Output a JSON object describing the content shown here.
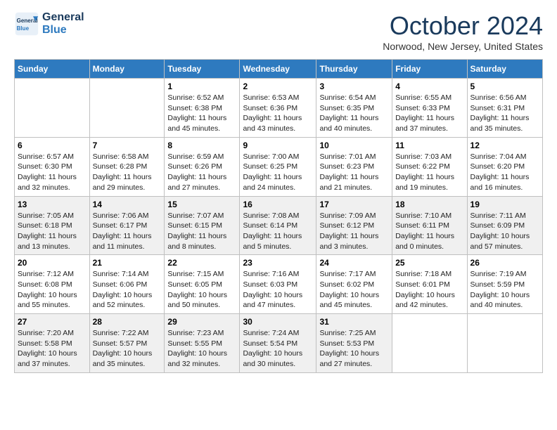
{
  "header": {
    "logo_general": "General",
    "logo_blue": "Blue",
    "month_title": "October 2024",
    "location": "Norwood, New Jersey, United States"
  },
  "weekdays": [
    "Sunday",
    "Monday",
    "Tuesday",
    "Wednesday",
    "Thursday",
    "Friday",
    "Saturday"
  ],
  "weeks": [
    [
      {
        "day": "",
        "info": ""
      },
      {
        "day": "",
        "info": ""
      },
      {
        "day": "1",
        "info": "Sunrise: 6:52 AM\nSunset: 6:38 PM\nDaylight: 11 hours and 45 minutes."
      },
      {
        "day": "2",
        "info": "Sunrise: 6:53 AM\nSunset: 6:36 PM\nDaylight: 11 hours and 43 minutes."
      },
      {
        "day": "3",
        "info": "Sunrise: 6:54 AM\nSunset: 6:35 PM\nDaylight: 11 hours and 40 minutes."
      },
      {
        "day": "4",
        "info": "Sunrise: 6:55 AM\nSunset: 6:33 PM\nDaylight: 11 hours and 37 minutes."
      },
      {
        "day": "5",
        "info": "Sunrise: 6:56 AM\nSunset: 6:31 PM\nDaylight: 11 hours and 35 minutes."
      }
    ],
    [
      {
        "day": "6",
        "info": "Sunrise: 6:57 AM\nSunset: 6:30 PM\nDaylight: 11 hours and 32 minutes."
      },
      {
        "day": "7",
        "info": "Sunrise: 6:58 AM\nSunset: 6:28 PM\nDaylight: 11 hours and 29 minutes."
      },
      {
        "day": "8",
        "info": "Sunrise: 6:59 AM\nSunset: 6:26 PM\nDaylight: 11 hours and 27 minutes."
      },
      {
        "day": "9",
        "info": "Sunrise: 7:00 AM\nSunset: 6:25 PM\nDaylight: 11 hours and 24 minutes."
      },
      {
        "day": "10",
        "info": "Sunrise: 7:01 AM\nSunset: 6:23 PM\nDaylight: 11 hours and 21 minutes."
      },
      {
        "day": "11",
        "info": "Sunrise: 7:03 AM\nSunset: 6:22 PM\nDaylight: 11 hours and 19 minutes."
      },
      {
        "day": "12",
        "info": "Sunrise: 7:04 AM\nSunset: 6:20 PM\nDaylight: 11 hours and 16 minutes."
      }
    ],
    [
      {
        "day": "13",
        "info": "Sunrise: 7:05 AM\nSunset: 6:18 PM\nDaylight: 11 hours and 13 minutes."
      },
      {
        "day": "14",
        "info": "Sunrise: 7:06 AM\nSunset: 6:17 PM\nDaylight: 11 hours and 11 minutes."
      },
      {
        "day": "15",
        "info": "Sunrise: 7:07 AM\nSunset: 6:15 PM\nDaylight: 11 hours and 8 minutes."
      },
      {
        "day": "16",
        "info": "Sunrise: 7:08 AM\nSunset: 6:14 PM\nDaylight: 11 hours and 5 minutes."
      },
      {
        "day": "17",
        "info": "Sunrise: 7:09 AM\nSunset: 6:12 PM\nDaylight: 11 hours and 3 minutes."
      },
      {
        "day": "18",
        "info": "Sunrise: 7:10 AM\nSunset: 6:11 PM\nDaylight: 11 hours and 0 minutes."
      },
      {
        "day": "19",
        "info": "Sunrise: 7:11 AM\nSunset: 6:09 PM\nDaylight: 10 hours and 57 minutes."
      }
    ],
    [
      {
        "day": "20",
        "info": "Sunrise: 7:12 AM\nSunset: 6:08 PM\nDaylight: 10 hours and 55 minutes."
      },
      {
        "day": "21",
        "info": "Sunrise: 7:14 AM\nSunset: 6:06 PM\nDaylight: 10 hours and 52 minutes."
      },
      {
        "day": "22",
        "info": "Sunrise: 7:15 AM\nSunset: 6:05 PM\nDaylight: 10 hours and 50 minutes."
      },
      {
        "day": "23",
        "info": "Sunrise: 7:16 AM\nSunset: 6:03 PM\nDaylight: 10 hours and 47 minutes."
      },
      {
        "day": "24",
        "info": "Sunrise: 7:17 AM\nSunset: 6:02 PM\nDaylight: 10 hours and 45 minutes."
      },
      {
        "day": "25",
        "info": "Sunrise: 7:18 AM\nSunset: 6:01 PM\nDaylight: 10 hours and 42 minutes."
      },
      {
        "day": "26",
        "info": "Sunrise: 7:19 AM\nSunset: 5:59 PM\nDaylight: 10 hours and 40 minutes."
      }
    ],
    [
      {
        "day": "27",
        "info": "Sunrise: 7:20 AM\nSunset: 5:58 PM\nDaylight: 10 hours and 37 minutes."
      },
      {
        "day": "28",
        "info": "Sunrise: 7:22 AM\nSunset: 5:57 PM\nDaylight: 10 hours and 35 minutes."
      },
      {
        "day": "29",
        "info": "Sunrise: 7:23 AM\nSunset: 5:55 PM\nDaylight: 10 hours and 32 minutes."
      },
      {
        "day": "30",
        "info": "Sunrise: 7:24 AM\nSunset: 5:54 PM\nDaylight: 10 hours and 30 minutes."
      },
      {
        "day": "31",
        "info": "Sunrise: 7:25 AM\nSunset: 5:53 PM\nDaylight: 10 hours and 27 minutes."
      },
      {
        "day": "",
        "info": ""
      },
      {
        "day": "",
        "info": ""
      }
    ]
  ]
}
